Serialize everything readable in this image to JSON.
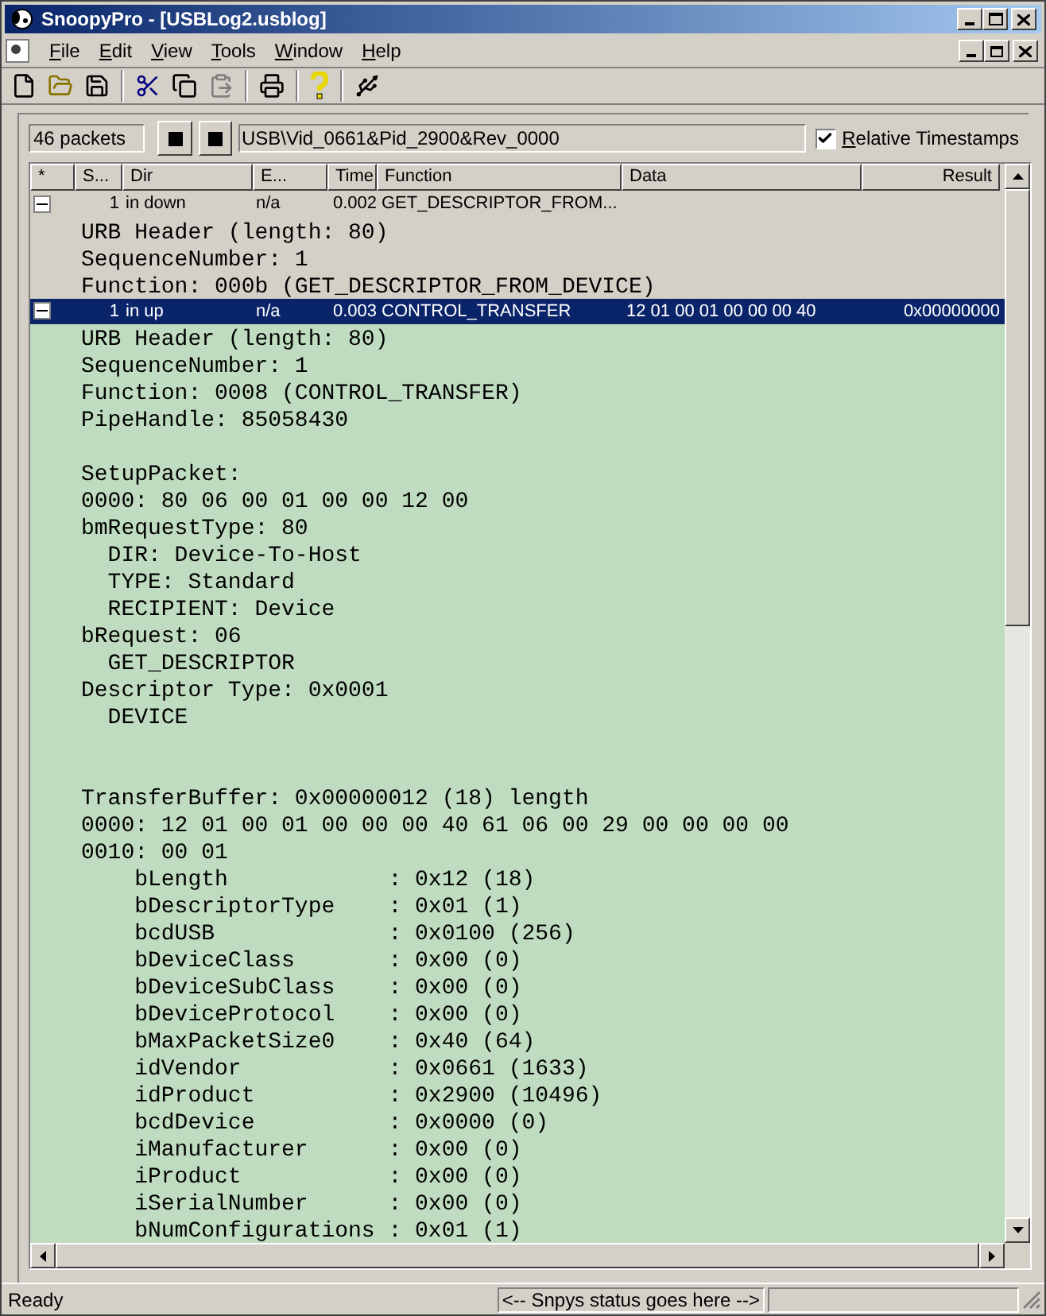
{
  "window": {
    "title": "SnoopyPro - [USBLog2.usblog]"
  },
  "menu": [
    "File",
    "Edit",
    "View",
    "Tools",
    "Window",
    "Help"
  ],
  "toolbar": [
    {
      "kind": "new",
      "disabled": false
    },
    {
      "kind": "open",
      "disabled": false
    },
    {
      "kind": "save",
      "disabled": false
    },
    {
      "kind": "sep"
    },
    {
      "kind": "cut",
      "disabled": false
    },
    {
      "kind": "copy",
      "disabled": false
    },
    {
      "kind": "paste",
      "disabled": true
    },
    {
      "kind": "sep"
    },
    {
      "kind": "print",
      "disabled": false
    },
    {
      "kind": "sep"
    },
    {
      "kind": "help",
      "disabled": false
    },
    {
      "kind": "sep"
    },
    {
      "kind": "usb",
      "disabled": false
    }
  ],
  "controls": {
    "packet_count": "46 packets",
    "device": "USB\\Vid_0661&Pid_2900&Rev_0000",
    "relative_timestamps": {
      "label": "Relative Timestamps",
      "checked": true
    }
  },
  "columns": [
    "*",
    "S...",
    "Dir",
    "E...",
    "Time",
    "Function",
    "Data",
    "Result"
  ],
  "packets": [
    {
      "expanded": true,
      "selected": false,
      "color": "#d4d0c8",
      "seq": "1",
      "dir": "in down",
      "endpoint": "n/a",
      "time": "0.002",
      "function": "GET_DESCRIPTOR_FROM...",
      "details": [
        {
          "kind": "text",
          "text": "URB Header (length: 80)"
        },
        {
          "kind": "text",
          "text": "SequenceNumber: 1"
        },
        {
          "kind": "text",
          "text": "Function: 000b (GET_DESCRIPTOR_FROM_DEVICE)"
        }
      ]
    },
    {
      "expanded": true,
      "selected": true,
      "color": "#c0dcc0",
      "seq": "1",
      "dir": "in up",
      "endpoint": "n/a",
      "time": "0.003",
      "function": "CONTROL_TRANSFER",
      "data": "12 01 00 01 00 00 00 40",
      "result": "0x00000000",
      "details": [
        {
          "kind": "text",
          "text": "URB Header (length: 80)"
        },
        {
          "kind": "text",
          "text": "SequenceNumber: 1"
        },
        {
          "kind": "text",
          "text": "Function: 0008 (CONTROL_TRANSFER)"
        },
        {
          "kind": "text",
          "text": "PipeHandle: 85058430"
        },
        {
          "kind": "blank"
        },
        {
          "kind": "text",
          "text": "SetupPacket:"
        },
        {
          "kind": "text",
          "text": "0000: 80 06 00 01 00 00 12 00"
        },
        {
          "kind": "text",
          "text": "bmRequestType: 80"
        },
        {
          "kind": "text",
          "text": "  DIR: Device-To-Host"
        },
        {
          "kind": "text",
          "text": "  TYPE: Standard"
        },
        {
          "kind": "text",
          "text": "  RECIPIENT: Device"
        },
        {
          "kind": "text",
          "text": "bRequest: 06"
        },
        {
          "kind": "text",
          "text": "  GET_DESCRIPTOR"
        },
        {
          "kind": "text",
          "text": "Descriptor Type: 0x0001"
        },
        {
          "kind": "text",
          "text": "  DEVICE"
        },
        {
          "kind": "blank"
        },
        {
          "kind": "blank"
        },
        {
          "kind": "text",
          "text": "TransferBuffer: 0x00000012 (18) length"
        },
        {
          "kind": "text",
          "text": "0000: 12 01 00 01 00 00 00 40 61 06 00 29 00 00 00 00"
        },
        {
          "kind": "text",
          "text": "0010: 00 01"
        },
        {
          "kind": "text",
          "text": "    bLength            : 0x12 (18)"
        },
        {
          "kind": "text",
          "text": "    bDescriptorType    : 0x01 (1)"
        },
        {
          "kind": "text",
          "text": "    bcdUSB             : 0x0100 (256)"
        },
        {
          "kind": "text",
          "text": "    bDeviceClass       : 0x00 (0)"
        },
        {
          "kind": "text",
          "text": "    bDeviceSubClass    : 0x00 (0)"
        },
        {
          "kind": "text",
          "text": "    bDeviceProtocol    : 0x00 (0)"
        },
        {
          "kind": "text",
          "text": "    bMaxPacketSize0    : 0x40 (64)"
        },
        {
          "kind": "text",
          "text": "    idVendor           : 0x0661 (1633)"
        },
        {
          "kind": "text",
          "text": "    idProduct          : 0x2900 (10496)"
        },
        {
          "kind": "text",
          "text": "    bcdDevice          : 0x0000 (0)"
        },
        {
          "kind": "text",
          "text": "    iManufacturer      : 0x00 (0)"
        },
        {
          "kind": "text",
          "text": "    iProduct           : 0x00 (0)"
        },
        {
          "kind": "text",
          "text": "    iSerialNumber      : 0x00 (0)"
        },
        {
          "kind": "text",
          "text": "    bNumConfigurations : 0x01 (1)"
        }
      ]
    }
  ],
  "status_bar": {
    "message": "Ready",
    "panel": "<-- Snpys status goes here -->"
  }
}
